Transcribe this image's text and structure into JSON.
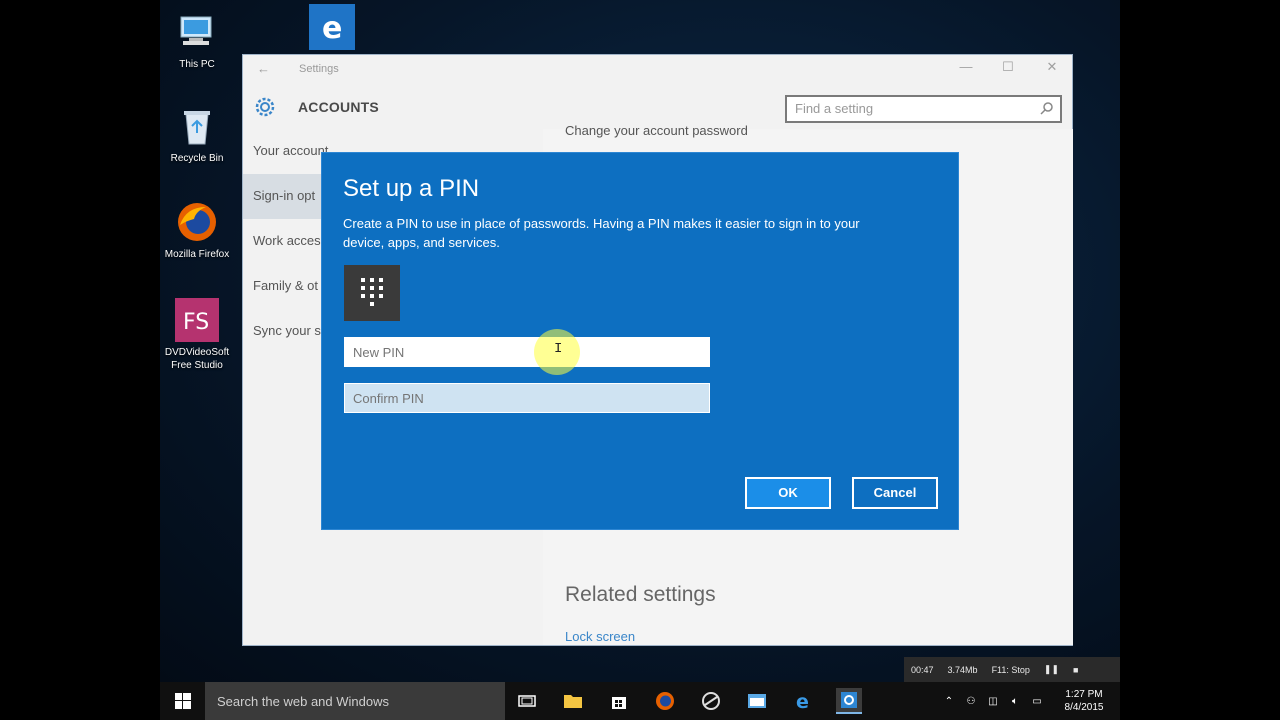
{
  "desktop": {
    "icons": [
      {
        "label": "This PC"
      },
      {
        "label": ""
      },
      {
        "label": "Recycle Bin"
      },
      {
        "label": "Mozilla Firefox"
      },
      {
        "label": "DVDVideoSoft Free Studio"
      }
    ]
  },
  "settings": {
    "window_title": "Settings",
    "heading": "ACCOUNTS",
    "search_placeholder": "Find a setting",
    "sidebar": [
      {
        "label": "Your account"
      },
      {
        "label": "Sign-in opt"
      },
      {
        "label": "Work acces"
      },
      {
        "label": "Family & ot"
      },
      {
        "label": "Sync your s"
      }
    ],
    "content": {
      "change_password": "Change your account password",
      "related_heading": "Related settings",
      "lock_screen_link": "Lock screen"
    }
  },
  "pin_dialog": {
    "title": "Set up a PIN",
    "description": "Create a PIN to use in place of passwords. Having a PIN makes it easier to sign in to your device, apps, and services.",
    "new_pin_placeholder": "New PIN",
    "confirm_pin_placeholder": "Confirm PIN",
    "ok_label": "OK",
    "cancel_label": "Cancel"
  },
  "recorder": {
    "time": "00:47",
    "size": "3.74Mb",
    "stop_hint": "F11: Stop"
  },
  "taskbar": {
    "search_placeholder": "Search the web and Windows",
    "clock_time": "1:27 PM",
    "clock_date": "8/4/2015"
  },
  "colors": {
    "dialog_blue": "#0d6fc1",
    "ok_button": "#1b8ee8",
    "link_blue": "#3a86c9"
  }
}
